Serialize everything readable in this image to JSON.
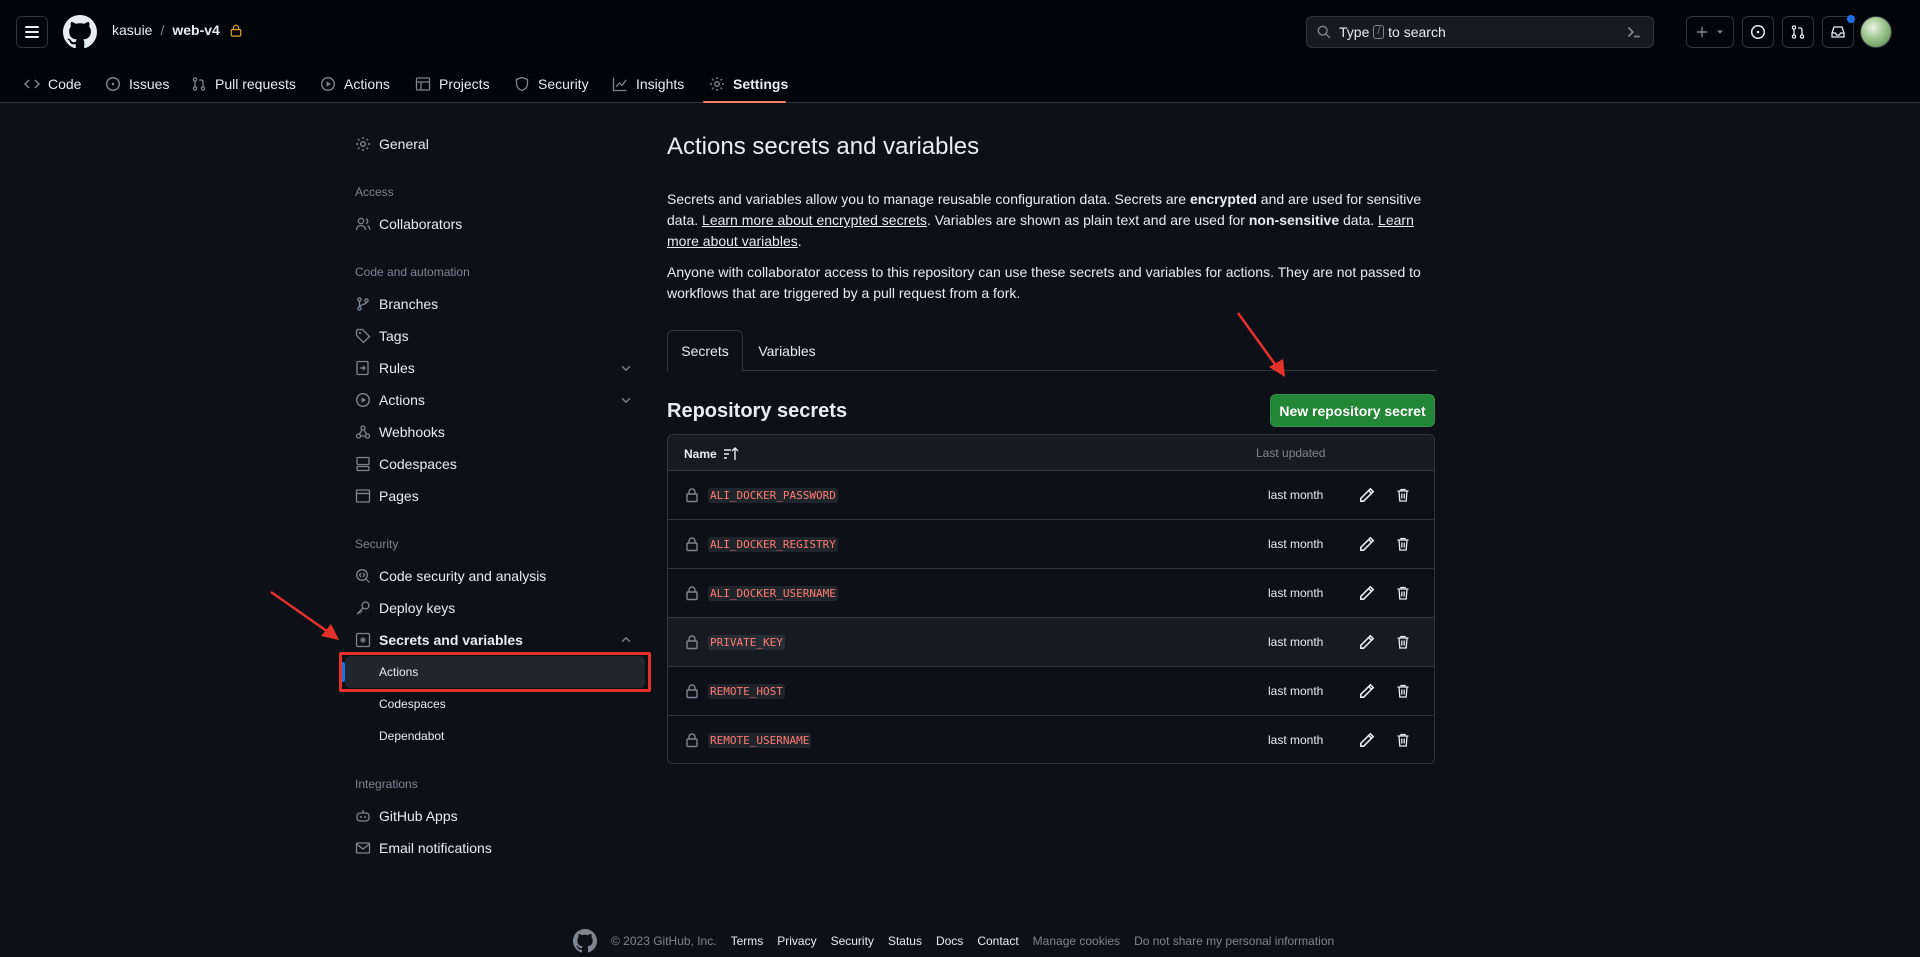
{
  "header": {
    "owner": "kasuie",
    "separator": "/",
    "repo": "web-v4",
    "search": {
      "prefix": "Type",
      "key": "/",
      "suffix": "to search"
    }
  },
  "repo_nav": [
    {
      "label": "Code",
      "icon": "code-icon"
    },
    {
      "label": "Issues",
      "icon": "issue-icon"
    },
    {
      "label": "Pull requests",
      "icon": "pull-request-icon"
    },
    {
      "label": "Actions",
      "icon": "play-icon"
    },
    {
      "label": "Projects",
      "icon": "table-icon"
    },
    {
      "label": "Security",
      "icon": "shield-icon"
    },
    {
      "label": "Insights",
      "icon": "graph-icon"
    },
    {
      "label": "Settings",
      "icon": "gear-icon",
      "active": true
    }
  ],
  "sidebar": {
    "general": "General",
    "access_heading": "Access",
    "collaborators": "Collaborators",
    "code_heading": "Code and automation",
    "branches": "Branches",
    "tags": "Tags",
    "rules": "Rules",
    "actions": "Actions",
    "webhooks": "Webhooks",
    "codespaces": "Codespaces",
    "pages": "Pages",
    "security_heading": "Security",
    "code_security": "Code security and analysis",
    "deploy_keys": "Deploy keys",
    "secrets_vars": "Secrets and variables",
    "sub_actions": "Actions",
    "sub_codespaces": "Codespaces",
    "sub_dependabot": "Dependabot",
    "integrations_heading": "Integrations",
    "github_apps": "GitHub Apps",
    "email_notifications": "Email notifications"
  },
  "main": {
    "title": "Actions secrets and variables",
    "desc1_a": "Secrets and variables allow you to manage reusable configuration data. Secrets are ",
    "desc1_b": "encrypted",
    "desc1_c": " and are used for sensitive data. ",
    "desc1_link1": "Learn more about encrypted secrets",
    "desc1_d": ". Variables are shown as plain text and are used for ",
    "desc1_e": "non-sensitive",
    "desc1_f": " data. ",
    "desc1_link2": "Learn more about variables",
    "desc1_g": ".",
    "desc2": "Anyone with collaborator access to this repository can use these secrets and variables for actions. They are not passed to workflows that are triggered by a pull request from a fork.",
    "tabs": [
      "Secrets",
      "Variables"
    ],
    "section_title": "Repository secrets",
    "new_button": "New repository secret",
    "table": {
      "col_name": "Name",
      "col_updated": "Last updated",
      "rows": [
        {
          "name": "ALI_DOCKER_PASSWORD",
          "updated": "last month"
        },
        {
          "name": "ALI_DOCKER_REGISTRY",
          "updated": "last month"
        },
        {
          "name": "ALI_DOCKER_USERNAME",
          "updated": "last month"
        },
        {
          "name": "PRIVATE_KEY",
          "updated": "last month"
        },
        {
          "name": "REMOTE_HOST",
          "updated": "last month"
        },
        {
          "name": "REMOTE_USERNAME",
          "updated": "last month"
        }
      ]
    }
  },
  "footer": {
    "copyright": "© 2023 GitHub, Inc.",
    "links": [
      "Terms",
      "Privacy",
      "Security",
      "Status",
      "Docs",
      "Contact"
    ],
    "muted_links": [
      "Manage cookies",
      "Do not share my personal information"
    ]
  },
  "colors": {
    "background": "#0d1117",
    "header": "#010409",
    "accent_underline": "#f78166",
    "primary_button": "#238636",
    "secret_name": "#ff7b72",
    "annotation": "#e5312b"
  }
}
